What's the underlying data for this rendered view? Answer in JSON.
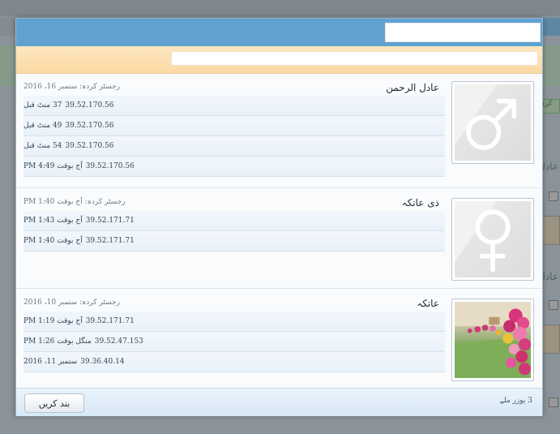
{
  "background": {
    "labels": [
      "عادل",
      "عادل"
    ],
    "chips": [
      "کرد"
    ]
  },
  "modal": {
    "search_value": "",
    "filter_value": "",
    "users": [
      {
        "name": "عادل الرحمن",
        "registered": "رجسٹر کردہ: ستمبر 16، 2016",
        "avatar": "male-icon",
        "sessions": [
          {
            "ip": "39.52.170.56",
            "time": "37 منٹ قبل"
          },
          {
            "ip": "39.52.170.56",
            "time": "49 منٹ قبل"
          },
          {
            "ip": "39.52.170.56",
            "time": "54 منٹ قبل"
          },
          {
            "ip": "39.52.170.56",
            "time": "آج بوقت 4:49 PM"
          }
        ]
      },
      {
        "name": "ذی عاتکہ",
        "registered": "رجسٹر کردہ: آج بوقت 1:40 PM",
        "avatar": "female-icon",
        "sessions": [
          {
            "ip": "39.52.171.71",
            "time": "آج بوقت 1:43 PM"
          },
          {
            "ip": "39.52.171.71",
            "time": "آج بوقت 1:40 PM"
          }
        ]
      },
      {
        "name": "عاتکہ",
        "registered": "رجسٹر کردہ: ستمبر 10، 2016",
        "avatar": "flower-garden-photo",
        "sessions": [
          {
            "ip": "39.52.171.71",
            "time": "آج بوقت 1:19 PM"
          },
          {
            "ip": "39.52.47.153",
            "time": "منگل بوقت 1:26 PM"
          },
          {
            "ip": "39.36.40.14",
            "time": "ستمبر 11، 2016"
          }
        ]
      }
    ],
    "footer": {
      "close_label": "بند کریں",
      "user_count": "3 یوزر ملے"
    }
  },
  "colors": {
    "header": "#5fa2d1",
    "subheader": "#fbd9a3",
    "footer": "#d7e8f6"
  }
}
